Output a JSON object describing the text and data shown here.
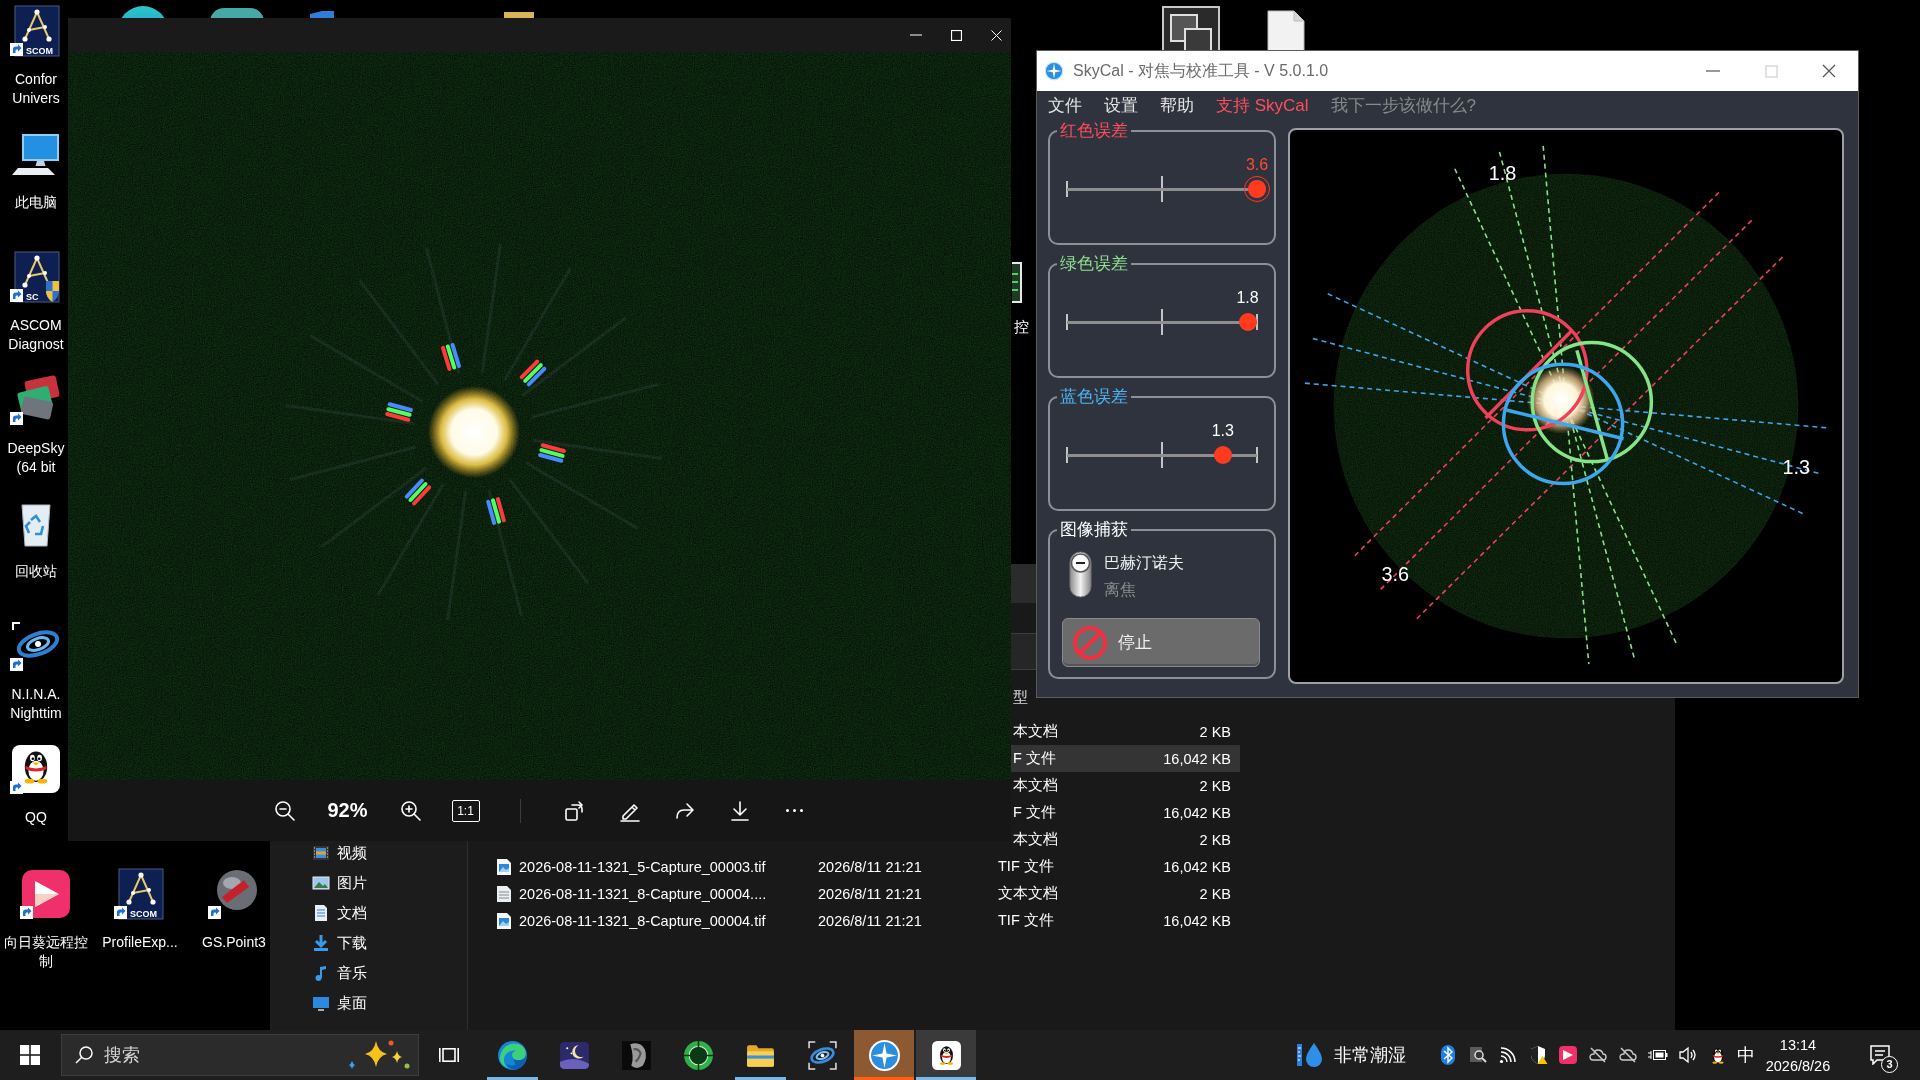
{
  "desktop": {
    "column_icons": [
      {
        "kind": "constellation",
        "logo_text": "SCOM",
        "label": "Confor Univers"
      },
      {
        "kind": "computer",
        "label": "此电脑"
      },
      {
        "kind": "constellation_shield",
        "logo_text": "SC",
        "label": "ASCOM Diagnost"
      },
      {
        "kind": "cards",
        "label": "DeepSky (64 bit"
      },
      {
        "kind": "recycle",
        "label": "回收站"
      },
      {
        "kind": "galaxy",
        "label": "N.I.N.A. Nighttim"
      },
      {
        "kind": "penguin",
        "label": "QQ"
      }
    ],
    "row_icons": [
      {
        "kind": "play",
        "label": "向日葵远程控制"
      },
      {
        "kind": "constellation",
        "logo_text": "SCOM",
        "label": "ProfileExp..."
      },
      {
        "kind": "globe",
        "label": "GS.Point3"
      }
    ]
  },
  "background_window": {
    "text": "控"
  },
  "explorer": {
    "sidebar": [
      {
        "kind": "videos",
        "label": "视频"
      },
      {
        "kind": "pictures",
        "label": "图片"
      },
      {
        "kind": "documents",
        "label": "文档"
      },
      {
        "kind": "downloads",
        "label": "下载"
      },
      {
        "kind": "music",
        "label": "音乐"
      },
      {
        "kind": "desktop",
        "label": "桌面"
      }
    ],
    "column_header": "型",
    "rows": [
      {
        "type": "本文档",
        "size": "2 KB",
        "selected": false
      },
      {
        "type": "F 文件",
        "size": "16,042 KB",
        "selected": true
      },
      {
        "type": "本文档",
        "size": "2 KB",
        "selected": false
      },
      {
        "type": "F 文件",
        "size": "16,042 KB",
        "selected": false
      },
      {
        "type": "本文档",
        "size": "2 KB",
        "selected": false
      },
      {
        "kind": "image",
        "name": "2026-08-11-1321_5-Capture_00003.tif",
        "date": "2026/8/11 21:21",
        "type": "TIF 文件",
        "size": "16,042 KB",
        "selected": false
      },
      {
        "kind": "text",
        "name": "2026-08-11-1321_8-Capture_00004....",
        "date": "2026/8/11 21:21",
        "type": "文本文档",
        "size": "2 KB",
        "selected": false
      },
      {
        "kind": "image",
        "name": "2026-08-11-1321_8-Capture_00004.tif",
        "date": "2026/8/11 21:21",
        "type": "TIF 文件",
        "size": "16,042 KB",
        "selected": false
      }
    ]
  },
  "photo_viewer": {
    "zoom": "92%",
    "actual_size": "1:1"
  },
  "skycal": {
    "title": "SkyCal - 对焦与校准工具 - V 5.0.1.0",
    "maximize_disabled": true,
    "menu": [
      {
        "label": "文件",
        "kind": "menu"
      },
      {
        "label": "设置",
        "kind": "menu"
      },
      {
        "label": "帮助",
        "kind": "menu"
      },
      {
        "label": "支持 SkyCal",
        "kind": "highlight"
      },
      {
        "label": "我下一步该做什么?",
        "kind": "hint"
      }
    ],
    "channels": [
      {
        "title": "红色误差",
        "color": "#ff4d5e",
        "reading": "3.6",
        "warning": true,
        "level": 1,
        "focused": true
      },
      {
        "title": "绿色误差",
        "color": "#8fe08f",
        "reading": "1.8",
        "warning": false,
        "level": 0.95,
        "focused": false
      },
      {
        "title": "蓝色误差",
        "color": "#4fb4f2",
        "reading": "1.3",
        "warning": false,
        "level": 0.82,
        "focused": false
      }
    ],
    "capture": {
      "title": "图像捕获",
      "on": true,
      "on_label": "巴赫汀诺夫",
      "off_label": "离焦",
      "button": "停止"
    },
    "view": {
      "overlays": [
        {
          "color": "#f0405a",
          "label": "3.6"
        },
        {
          "color": "#86e486",
          "label": "1.8"
        },
        {
          "color": "#3ea6ec",
          "label": "1.3"
        }
      ]
    }
  },
  "taskbar": {
    "search": {
      "placeholder": "搜索"
    },
    "apps": [
      {
        "kind": "swirl",
        "open": true,
        "focused": false,
        "attention": false
      },
      {
        "kind": "night_sky",
        "open": false,
        "focused": false,
        "attention": false
      },
      {
        "kind": "moon",
        "open": false,
        "focused": false,
        "attention": false
      },
      {
        "kind": "target",
        "open": false,
        "focused": false,
        "attention": false
      },
      {
        "kind": "folder",
        "open": true,
        "focused": false,
        "attention": false
      },
      {
        "kind": "galaxy",
        "open": false,
        "focused": false,
        "attention": false
      },
      {
        "kind": "compass",
        "open": true,
        "focused": false,
        "attention": true
      },
      {
        "kind": "penguin",
        "open": true,
        "focused": true,
        "attention": false
      }
    ],
    "weather": "非常潮湿",
    "input_method": "中",
    "time": "13:14",
    "date": "2026/8/26",
    "notification_count": "3"
  }
}
